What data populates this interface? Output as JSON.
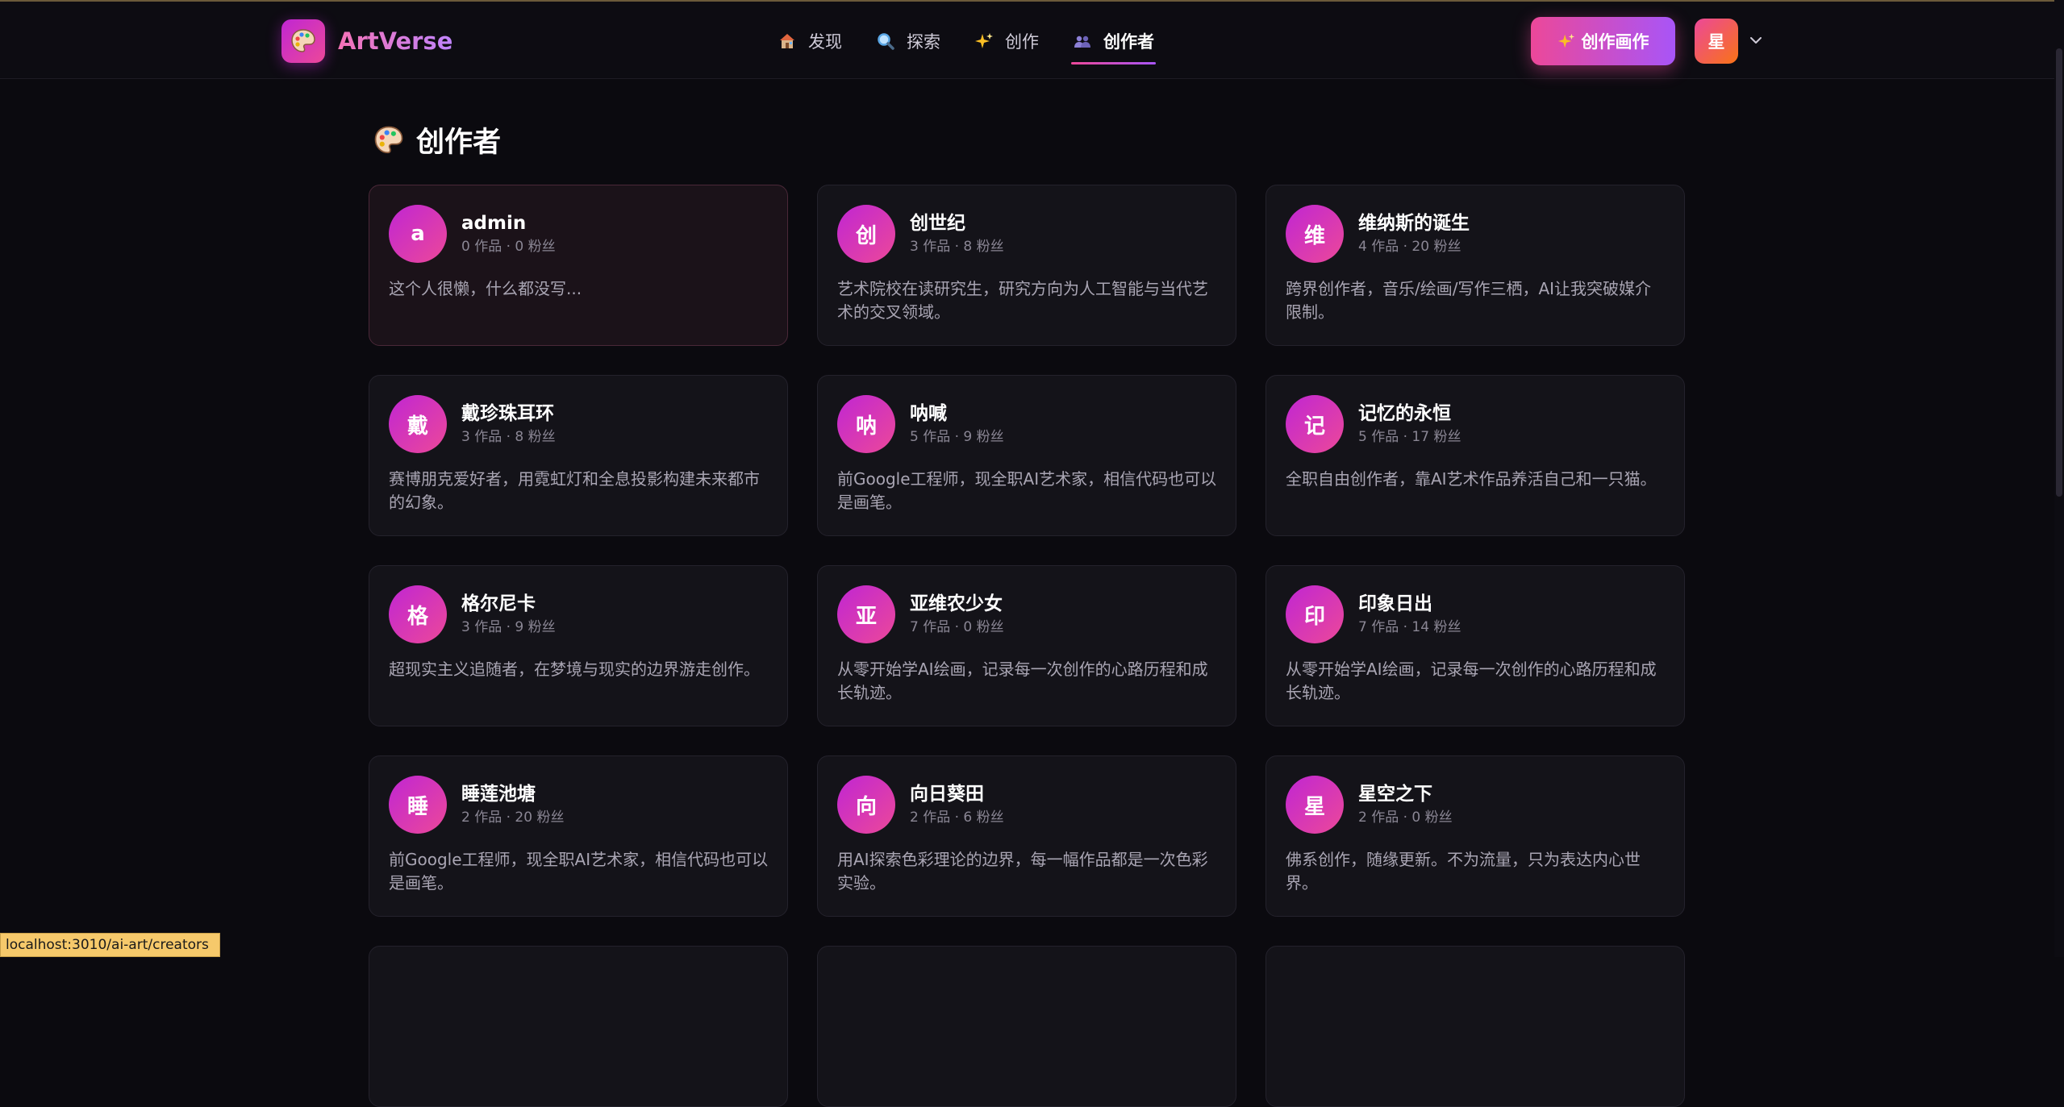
{
  "app": {
    "name": "ArtVerse"
  },
  "nav": {
    "items": [
      {
        "label": "发现",
        "icon": "house-icon",
        "active": false
      },
      {
        "label": "探索",
        "icon": "magnifier-icon",
        "active": false
      },
      {
        "label": "创作",
        "icon": "sparkles-icon",
        "active": false
      },
      {
        "label": "创作者",
        "icon": "people-icon",
        "active": true
      }
    ]
  },
  "header": {
    "create_button_label": "创作画作",
    "user_initial": "星"
  },
  "page": {
    "title": "创作者"
  },
  "creators": [
    {
      "initial": "a",
      "name": "admin",
      "stats": "0 作品 · 0 粉丝",
      "bio": "这个人很懒，什么都没写...",
      "highlight": true
    },
    {
      "initial": "创",
      "name": "创世纪",
      "stats": "3 作品 · 8 粉丝",
      "bio": "艺术院校在读研究生，研究方向为人工智能与当代艺术的交叉领域。"
    },
    {
      "initial": "维",
      "name": "维纳斯的诞生",
      "stats": "4 作品 · 20 粉丝",
      "bio": "跨界创作者，音乐/绘画/写作三栖，AI让我突破媒介限制。"
    },
    {
      "initial": "戴",
      "name": "戴珍珠耳环",
      "stats": "3 作品 · 8 粉丝",
      "bio": "赛博朋克爱好者，用霓虹灯和全息投影构建未来都市的幻象。"
    },
    {
      "initial": "呐",
      "name": "呐喊",
      "stats": "5 作品 · 9 粉丝",
      "bio": "前Google工程师，现全职AI艺术家，相信代码也可以是画笔。"
    },
    {
      "initial": "记",
      "name": "记忆的永恒",
      "stats": "5 作品 · 17 粉丝",
      "bio": "全职自由创作者，靠AI艺术作品养活自己和一只猫。"
    },
    {
      "initial": "格",
      "name": "格尔尼卡",
      "stats": "3 作品 · 9 粉丝",
      "bio": "超现实主义追随者，在梦境与现实的边界游走创作。"
    },
    {
      "initial": "亚",
      "name": "亚维农少女",
      "stats": "7 作品 · 0 粉丝",
      "bio": "从零开始学AI绘画，记录每一次创作的心路历程和成长轨迹。"
    },
    {
      "initial": "印",
      "name": "印象日出",
      "stats": "7 作品 · 14 粉丝",
      "bio": "从零开始学AI绘画，记录每一次创作的心路历程和成长轨迹。"
    },
    {
      "initial": "睡",
      "name": "睡莲池塘",
      "stats": "2 作品 · 20 粉丝",
      "bio": "前Google工程师，现全职AI艺术家，相信代码也可以是画笔。"
    },
    {
      "initial": "向",
      "name": "向日葵田",
      "stats": "2 作品 · 6 粉丝",
      "bio": "用AI探索色彩理论的边界，每一幅作品都是一次色彩实验。"
    },
    {
      "initial": "星",
      "name": "星空之下",
      "stats": "2 作品 · 0 粉丝",
      "bio": "佛系创作，随缘更新。不为流量，只为表达内心世界。"
    }
  ],
  "status_bar": {
    "url": "localhost:3010/ai-art/creators"
  },
  "colors": {
    "background": "#0b0a0f",
    "card": "#141319",
    "accent_pink": "#ec4899",
    "accent_purple": "#a855f7"
  }
}
